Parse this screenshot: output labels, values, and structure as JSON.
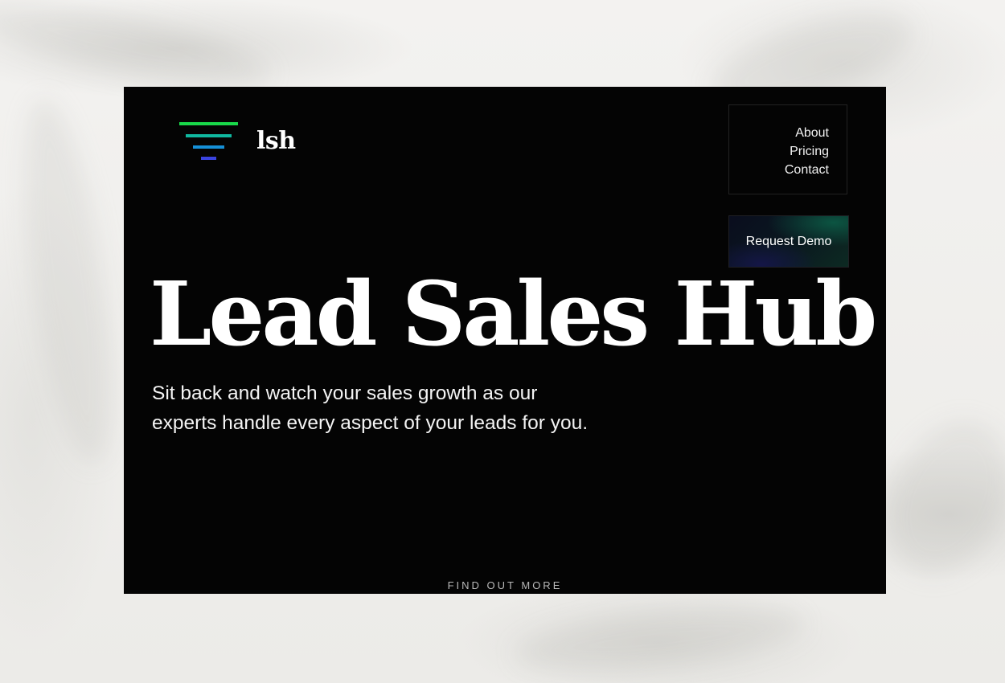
{
  "brand": {
    "name": "lsh",
    "logo_icon": "funnel-bars-icon",
    "logo_colors": [
      "#19d94a",
      "#10b8a0",
      "#1690d8",
      "#3a44e0"
    ]
  },
  "nav": {
    "items": [
      {
        "label": "About"
      },
      {
        "label": "Pricing"
      },
      {
        "label": "Contact"
      }
    ]
  },
  "cta": {
    "label": "Request Demo"
  },
  "hero": {
    "title": "Lead Sales Hub",
    "subtitle_line1": "Sit back and watch your sales growth as our",
    "subtitle_line2": "experts handle every aspect of your leads for you."
  },
  "footer": {
    "find_more": "FIND OUT MORE"
  },
  "colors": {
    "background": "#040404",
    "page_backdrop": "#efeeec",
    "text": "#ffffff"
  }
}
